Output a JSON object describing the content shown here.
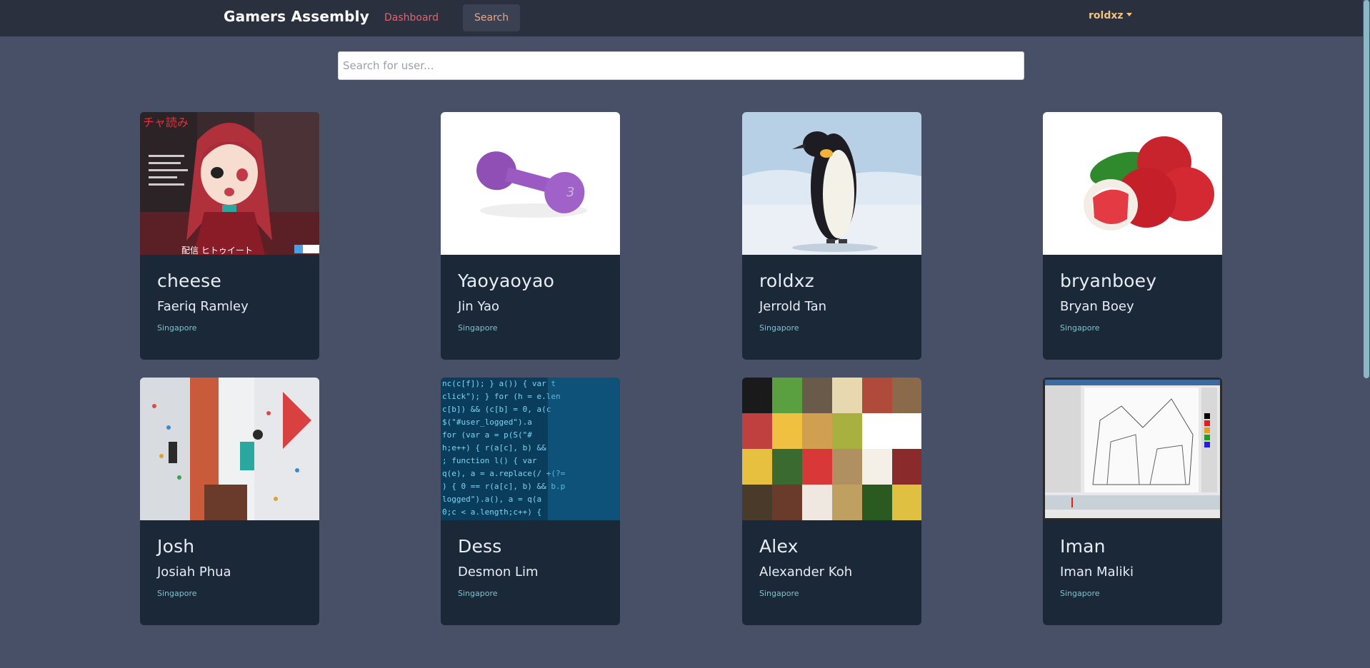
{
  "navbar": {
    "brand": "Gamers Assembly",
    "links": [
      {
        "label": "Dashboard"
      },
      {
        "label": "Search"
      }
    ],
    "user": "roldxz"
  },
  "search": {
    "placeholder": "Search for user..."
  },
  "cards": [
    {
      "username": "cheese",
      "fullname": "Faeriq Ramley",
      "location": "Singapore",
      "image": "anime-character-avatar"
    },
    {
      "username": "Yaoyaoyao",
      "fullname": "Jin Yao",
      "location": "Singapore",
      "image": "purple-dumbbell"
    },
    {
      "username": "roldxz",
      "fullname": "Jerrold Tan",
      "location": "Singapore",
      "image": "penguin-on-snow"
    },
    {
      "username": "bryanboey",
      "fullname": "Bryan Boey",
      "location": "Singapore",
      "image": "lychee-fruits"
    },
    {
      "username": "Josh",
      "fullname": "Josiah Phua",
      "location": "Singapore",
      "image": "climbing-wall"
    },
    {
      "username": "Dess",
      "fullname": "Desmon Lim",
      "location": "Singapore",
      "image": "code-screen"
    },
    {
      "username": "Alex",
      "fullname": "Alexander Koh",
      "location": "Singapore",
      "image": "food-grid"
    },
    {
      "username": "Iman",
      "fullname": "Iman Maliki",
      "location": "Singapore",
      "image": "sketch-software-screenshot"
    }
  ],
  "colors": {
    "background": "#475066",
    "navbar": "#2a303d",
    "card": "#1a2838",
    "dashboard_link": "#e0656e",
    "search_link": "#e8a58a",
    "user": "#f1c27b",
    "location": "#7fc3cf"
  }
}
